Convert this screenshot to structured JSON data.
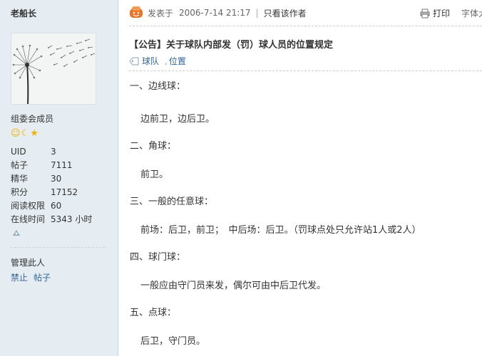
{
  "sidebar": {
    "username": "老船长",
    "group": "组委会成员",
    "stars": [
      "sun-icon",
      "moon-icon",
      "star-icon"
    ],
    "stats": [
      {
        "label": "UID",
        "value": "3"
      },
      {
        "label": "帖子",
        "value": "7111"
      },
      {
        "label": "精华",
        "value": "30"
      },
      {
        "label": "积分",
        "value": "17152"
      },
      {
        "label": "阅读权限",
        "value": "60"
      },
      {
        "label": "在线时间",
        "value": "5343 小时"
      }
    ],
    "manage_label": "管理此人",
    "manage_links": [
      "禁止",
      "帖子"
    ]
  },
  "post": {
    "posted_prefix": "发表于",
    "posted_time": "2006-7-14 21:17",
    "separator": "|",
    "author_only": "只看该作者",
    "print_label": "打印",
    "fontsize_label": "字体大小"
  },
  "title": "【公告】关于球队内部发（罚）球人员的位置规定",
  "tags": [
    "球队",
    "位置"
  ],
  "content": [
    "一、边线球：",
    "边前卫，边后卫。",
    "二、角球：",
    "前卫。",
    "三、一般的任意球：",
    "前场：后卫，前卫；　中后场：后卫。（罚球点处只允许站1人或2人）",
    "四、球门球：",
    "一般应由守门员来发，偶尔可由中后卫代发。",
    "五、点球：",
    "后卫，守门员。"
  ],
  "colors": {
    "sidebar_bg": "#e5edf2",
    "link": "#336699",
    "mood_icon": "#e8742a"
  }
}
